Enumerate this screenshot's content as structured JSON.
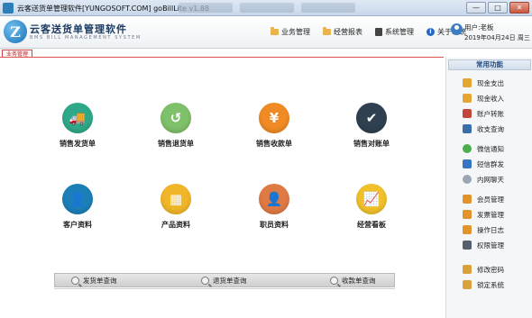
{
  "window": {
    "title": "云客送货单管理软件[YUNGOSOFT.COM]  goBillLite v1.88",
    "buttons": [
      "—",
      "□",
      "✕"
    ]
  },
  "brand": {
    "logo_letter": "Z",
    "title": "云客送货单管理软件",
    "subtitle": "BMS BILL MANAGEMENT SYSTEM"
  },
  "top_menu": [
    {
      "label": "业务管理",
      "icon": "folder-icon"
    },
    {
      "label": "经营报表",
      "icon": "folder-icon"
    },
    {
      "label": "系统管理",
      "icon": "book-icon"
    },
    {
      "label": "关于系统",
      "icon": "info-icon"
    }
  ],
  "user": {
    "label": "用户:老板",
    "date": "2019年04月24日 周三"
  },
  "tab": {
    "label": "业务管理"
  },
  "tiles": [
    {
      "label": "销售发货单",
      "icon": "truck-icon",
      "color": "#2fa889",
      "glyph": "🚚"
    },
    {
      "label": "销售退货单",
      "icon": "return-icon",
      "color": "#7fc06a",
      "glyph": "↺"
    },
    {
      "label": "销售收款单",
      "icon": "yen-icon",
      "color": "#f08a24",
      "glyph": "¥"
    },
    {
      "label": "销售对账单",
      "icon": "clipboard-icon",
      "color": "#2f4050",
      "glyph": "✔"
    },
    {
      "label": "客户资料",
      "icon": "customer-icon",
      "color": "#1c7fb8",
      "glyph": "👤"
    },
    {
      "label": "产品资料",
      "icon": "product-icon",
      "color": "#f0b528",
      "glyph": "▦"
    },
    {
      "label": "职员资料",
      "icon": "staff-icon",
      "color": "#e07a44",
      "glyph": "👤"
    },
    {
      "label": "经营看板",
      "icon": "board-icon",
      "color": "#f0c02a",
      "glyph": "📈"
    }
  ],
  "query_bar": [
    {
      "label": "发货单查询",
      "icon": "search-icon"
    },
    {
      "label": "退货单查询",
      "icon": "search-icon"
    },
    {
      "label": "收款单查询",
      "icon": "search-icon"
    }
  ],
  "sidebar": {
    "title": "常用功能",
    "items": [
      {
        "label": "现金支出",
        "icon": "cash-out-icon",
        "color": "#e5a531"
      },
      {
        "label": "现金收入",
        "icon": "cash-in-icon",
        "color": "#e5a531"
      },
      {
        "label": "账户转账",
        "icon": "transfer-icon",
        "color": "#c1463b"
      },
      {
        "label": "收支查询",
        "icon": "query-icon",
        "color": "#3b6fa8"
      },
      {
        "label": "微信通知",
        "icon": "wechat-icon",
        "color": "#4cae4c"
      },
      {
        "label": "短信群发",
        "icon": "sms-icon",
        "color": "#3575c2"
      },
      {
        "label": "内网聊天",
        "icon": "chat-icon",
        "color": "#9aa6b4"
      },
      {
        "label": "会员管理",
        "icon": "member-icon",
        "color": "#e0942a"
      },
      {
        "label": "发票管理",
        "icon": "invoice-icon",
        "color": "#e0942a"
      },
      {
        "label": "操作日志",
        "icon": "log-icon",
        "color": "#e0942a"
      },
      {
        "label": "权限管理",
        "icon": "permission-icon",
        "color": "#555f6b"
      },
      {
        "label": "修改密码",
        "icon": "key-icon",
        "color": "#d9a13a"
      },
      {
        "label": "锁定系统",
        "icon": "lock-icon",
        "color": "#d9a13a"
      }
    ]
  }
}
